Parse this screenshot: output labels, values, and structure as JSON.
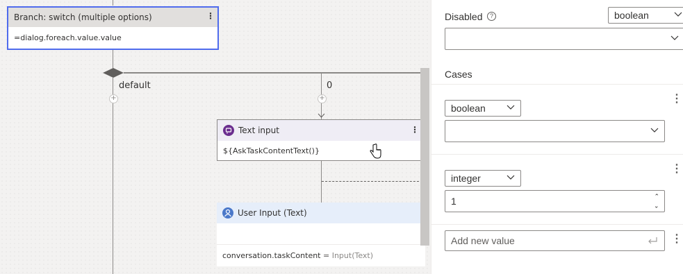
{
  "canvas": {
    "switch_node": {
      "title": "Branch: switch (multiple options)",
      "condition": "=dialog.foreach.value.value"
    },
    "branch_labels": [
      "default",
      "0"
    ],
    "text_input_node": {
      "title": "Text input",
      "expression": "${AskTaskContentText()}"
    },
    "user_input_node": {
      "title": "User Input (Text)",
      "property": "conversation.taskContent",
      "equals": "=",
      "value_type": "Input(Text)"
    }
  },
  "panel": {
    "disabled_label": "Disabled",
    "disabled_type": "boolean",
    "disabled_value": "",
    "cases_label": "Cases",
    "cases": [
      {
        "type": "boolean",
        "value": ""
      },
      {
        "type": "integer",
        "value": "1"
      }
    ],
    "add_placeholder": "Add new value"
  },
  "colors": {
    "accent": "#4f6bed",
    "text_input_icon": "#6b2e8f",
    "user_input_icon": "#4a78c9",
    "text_input_header": "#efedf5",
    "user_input_header": "#e6eefa"
  }
}
